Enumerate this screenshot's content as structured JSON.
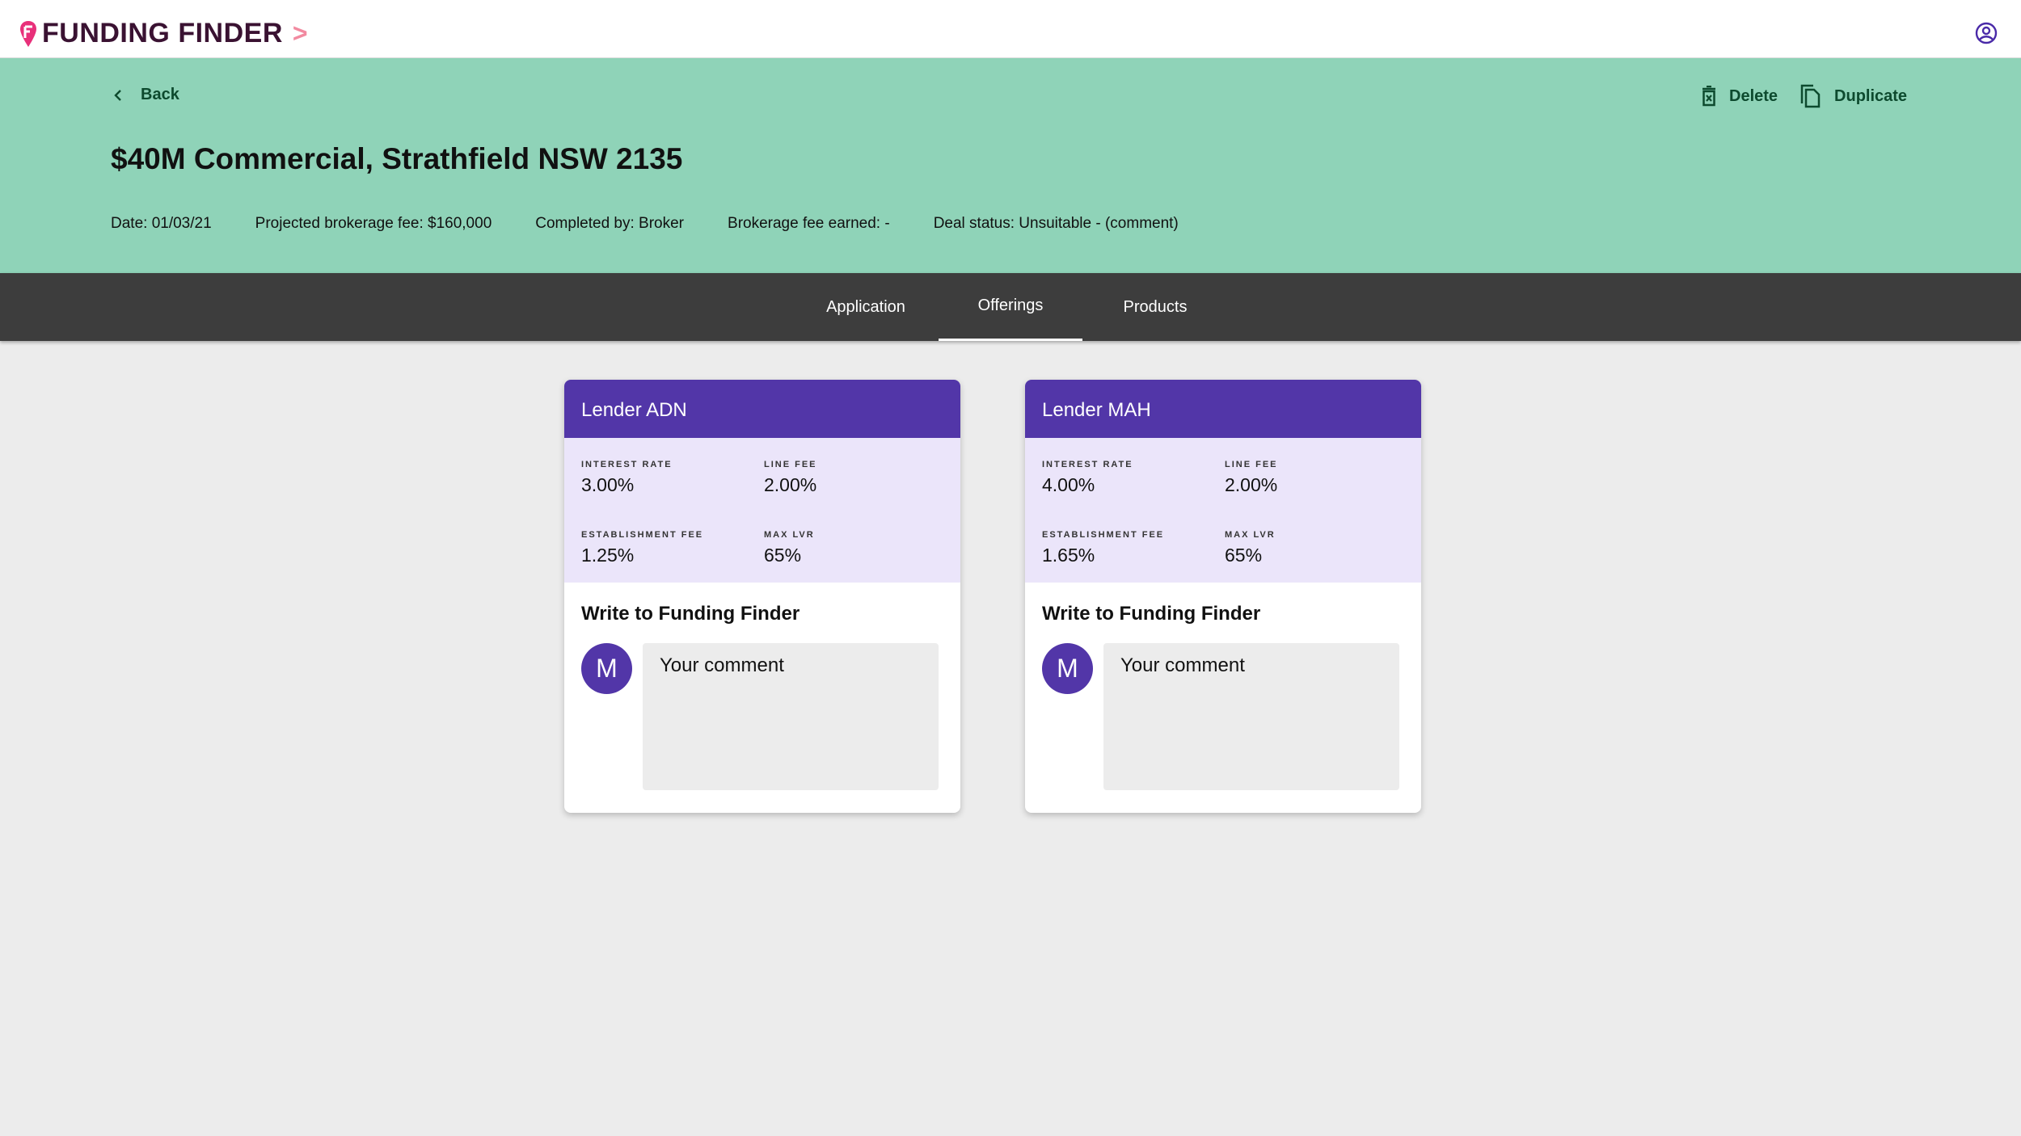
{
  "brand": {
    "name": "FUNDING FINDER",
    "chevron": ">",
    "logo_color": "#e8307a"
  },
  "header": {
    "user_icon": "user-circle-icon"
  },
  "deal": {
    "back_label": "Back",
    "delete_label": "Delete",
    "duplicate_label": "Duplicate",
    "title": "$40M Commercial, Strathfield NSW 2135",
    "meta": [
      "Date: 01/03/21",
      "Projected brokerage fee: $160,000",
      "Completed by: Broker",
      "Brokerage fee earned: -",
      "Deal status: Unsuitable - (comment)"
    ]
  },
  "tabs": [
    {
      "label": "Application"
    },
    {
      "label": "Offerings",
      "active": true
    },
    {
      "label": "Products"
    }
  ],
  "cards": [
    {
      "lender": "Lender ADN",
      "interest_label": "INTEREST RATE",
      "interest": "3.00%",
      "line_label": "LINE FEE",
      "line": "2.00%",
      "est_label": "ESTABLISHMENT FEE",
      "est": "1.25%",
      "lvr_label": "MAX LVR",
      "lvr": "65%",
      "write": "Write to Funding Finder",
      "avatar": "M",
      "placeholder": "Your comment"
    },
    {
      "lender": "Lender MAH",
      "interest_label": "INTEREST RATE",
      "interest": "4.00%",
      "line_label": "LINE FEE",
      "line": "2.00%",
      "est_label": "ESTABLISHMENT FEE",
      "est": "1.65%",
      "lvr_label": "MAX LVR",
      "lvr": "65%",
      "write": "Write to Funding Finder",
      "avatar": "M",
      "placeholder": "Your comment"
    }
  ],
  "colors": {
    "band": "#8fd3b8",
    "tabbar": "#3d3d3d",
    "purple": "#5236a8",
    "lavender": "#ebe5fa"
  }
}
